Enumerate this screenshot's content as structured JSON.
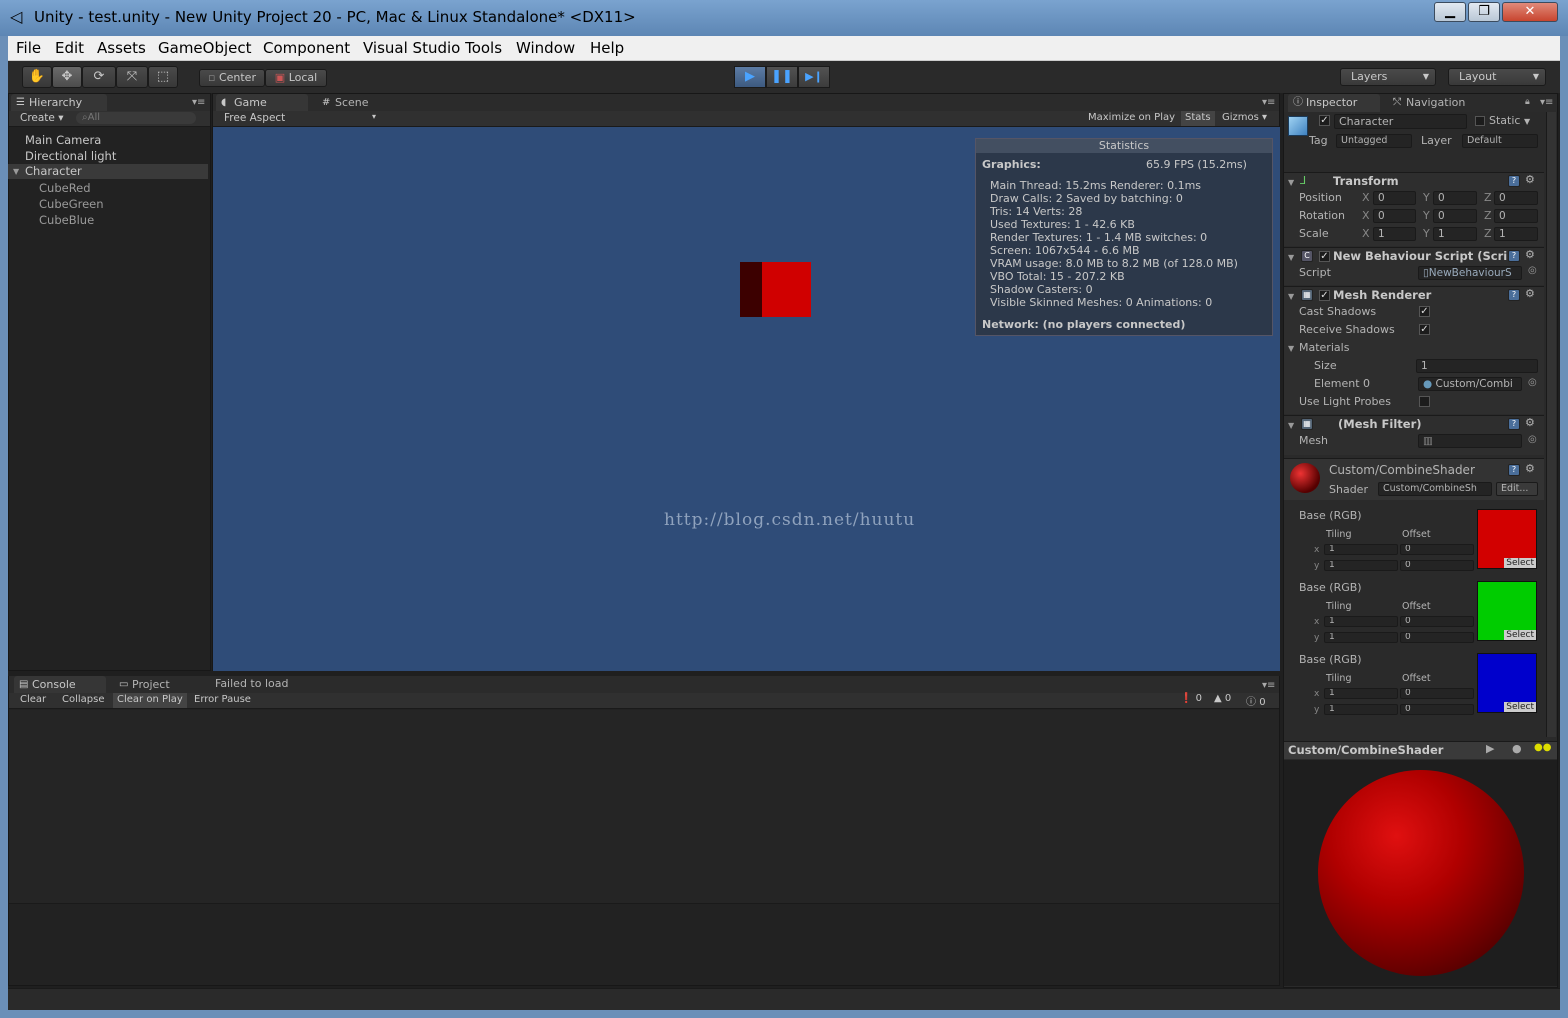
{
  "window": {
    "title": "Unity - test.unity - New Unity Project 20 - PC, Mac & Linux Standalone* <DX11>",
    "minimize": "▁",
    "maximize": "❐",
    "close": "✕"
  },
  "menu": [
    "File",
    "Edit",
    "Assets",
    "GameObject",
    "Component",
    "Visual Studio Tools",
    "Window",
    "Help"
  ],
  "toolbar": {
    "pivot": "Center",
    "space": "Local",
    "layers": "Layers",
    "layout": "Layout",
    "play": "▶",
    "pause": "❚❚",
    "step": "▶❙"
  },
  "hierarchy": {
    "tab": "Hierarchy",
    "create": "Create",
    "search_placeholder": "All",
    "items": [
      "Main Camera",
      "Directional light",
      "Character",
      "CubeRed",
      "CubeGreen",
      "CubeBlue"
    ]
  },
  "game": {
    "tab_game": "Game",
    "tab_scene": "Scene",
    "aspect": "Free Aspect",
    "maximize": "Maximize on Play",
    "stats": "Stats",
    "gizmos": "Gizmos",
    "watermark": "http://blog.csdn.net/huutu"
  },
  "stats": {
    "title": "Statistics",
    "graphics_label": "Graphics:",
    "fps": "65.9 FPS (15.2ms)",
    "lines": [
      "Main Thread: 15.2ms  Renderer: 0.1ms",
      "Draw Calls: 2        Saved by batching: 0",
      "Tris: 14   Verts: 28",
      "Used Textures: 1 - 42.6 KB",
      "Render Textures: 1 - 1.4 MB      switches: 0",
      "Screen: 1067x544 - 6.6 MB",
      "VRAM usage: 8.0 MB to 8.2 MB (of 128.0 MB)",
      "VBO Total: 15 - 207.2 KB",
      "Shadow Casters: 0",
      "Visible Skinned Meshes: 0        Animations: 0"
    ],
    "network": "Network: (no players connected)"
  },
  "console": {
    "tab_console": "Console",
    "tab_project": "Project",
    "status": "Failed to load",
    "clear": "Clear",
    "collapse": "Collapse",
    "clear_on_play": "Clear on Play",
    "error_pause": "Error Pause",
    "count_errors": "0",
    "count_warnings": "0",
    "count_logs": "0"
  },
  "inspector": {
    "tab_inspector": "Inspector",
    "tab_navigation": "Navigation",
    "object_name": "Character",
    "static": "Static",
    "tag_label": "Tag",
    "tag": "Untagged",
    "layer_label": "Layer",
    "layer": "Default",
    "transform": {
      "title": "Transform",
      "position_label": "Position",
      "rotation_label": "Rotation",
      "scale_label": "Scale",
      "position": [
        "0",
        "0",
        "0"
      ],
      "rotation": [
        "0",
        "0",
        "0"
      ],
      "scale": [
        "1",
        "1",
        "1"
      ]
    },
    "script": {
      "title": "New Behaviour Script (Scri",
      "label": "Script",
      "value": "NewBehaviourS"
    },
    "mesh_renderer": {
      "title": "Mesh Renderer",
      "cast_shadows": "Cast Shadows",
      "receive_shadows": "Receive Shadows",
      "materials": "Materials",
      "size_label": "Size",
      "size": "1",
      "element_label": "Element 0",
      "element": "Custom/Combi",
      "light_probes": "Use Light Probes"
    },
    "mesh_filter": {
      "title": "(Mesh Filter)",
      "mesh_label": "Mesh",
      "mesh_value": ""
    },
    "material": {
      "name": "Custom/CombineShader",
      "shader_label": "Shader",
      "shader": "Custom/CombineSh",
      "edit": "Edit...",
      "tiling": "Tiling",
      "offset": "Offset",
      "select": "Select",
      "slots": [
        {
          "label": "Base (RGB)",
          "tx": "1",
          "ty": "1",
          "ox": "0",
          "oy": "0",
          "color": "#d20000"
        },
        {
          "label": "Base (RGB)",
          "tx": "1",
          "ty": "1",
          "ox": "0",
          "oy": "0",
          "color": "#00cc00"
        },
        {
          "label": "Base (RGB)",
          "tx": "1",
          "ty": "1",
          "ox": "0",
          "oy": "0",
          "color": "#0000cc"
        }
      ]
    },
    "preview_title": "Custom/CombineShader"
  }
}
